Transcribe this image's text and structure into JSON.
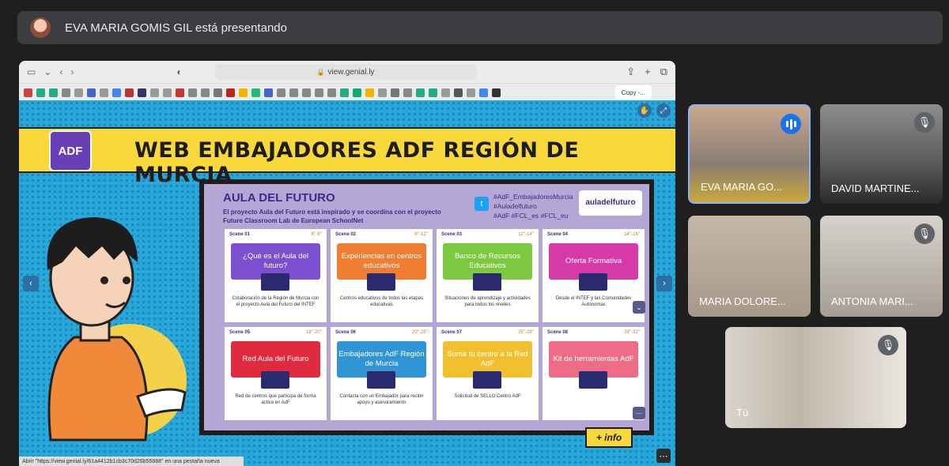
{
  "presenter": {
    "text": "EVA MARIA GOMIS GIL está presentando"
  },
  "browser": {
    "url": "view.genial.ly",
    "active_tab": "Copy -...",
    "status_text": "Abrir \"https://view.genial.ly/61a4412b1cb3c70d26b55888\" en una pestaña nueva"
  },
  "genially": {
    "title": "WEB EMBAJADORES ADF REGIÓN DE MURCIA",
    "logo_text": "ADF",
    "panel": {
      "title": "AULA DEL FUTURO",
      "description": "El proyecto Aula del Futuro está inspirado y se coordina con el proyecto Future Classroom Lab de European SchoolNet",
      "tags": [
        "#AdF_EmbajadoresMurcia",
        "#Auladelfuturo",
        "#AdF #FCL_es #FCL_eu"
      ],
      "logo": "auladelfuturo"
    },
    "scenes": [
      {
        "label": "Scene 01",
        "time": "6''-9''",
        "title": "¿Qué es el Aula del futuro?",
        "desc": "Colaboración de la Región de Murcia con el proyecto Aula del Futuro del INTEF",
        "color": "#7b4fd0"
      },
      {
        "label": "Scene 02",
        "time": "9''-12''",
        "title": "Experiencias en centros educativos",
        "desc": "Centros educativos de todos las etapas educativas",
        "color": "#f07d32"
      },
      {
        "label": "Scene 03",
        "time": "12''-14''",
        "title": "Banco de Recursos Educativos",
        "desc": "Situaciones de aprendizaje y actividades para todos los niveles",
        "color": "#7cc83f"
      },
      {
        "label": "Scene 04",
        "time": "14''-18''",
        "title": "Oferta Formativa",
        "desc": "Desde el INTEF y las Comunidades Autónomas",
        "color": "#d63aa8"
      },
      {
        "label": "Scene 05",
        "time": "18''-20''",
        "title": "Red Aula del Futuro",
        "desc": "Red de centros que participa de forma activa en AdF",
        "color": "#e02a3e"
      },
      {
        "label": "Scene 06",
        "time": "20''-25''",
        "title": "Embajadores AdF Región de Murcia",
        "desc": "Contacta con un Embajador para recibir apoyo y asesoramiento",
        "color": "#2f95d4"
      },
      {
        "label": "Scene 07",
        "time": "25''-28''",
        "title": "Suma tu centro a la Red AdF",
        "desc": "Solicitud de SELLO Centro AdF",
        "color": "#f2c02e"
      },
      {
        "label": "Scene 08",
        "time": "28''-32''",
        "title": "Kit de herramientas AdF",
        "desc": "",
        "color": "#ee6d86"
      }
    ],
    "info_button": "+ info"
  },
  "participants": [
    {
      "name": "EVA MARIA GO...",
      "muted": false,
      "speaking": true
    },
    {
      "name": "DAVID MARTINE...",
      "muted": true,
      "speaking": false
    },
    {
      "name": "MARIA DOLORE...",
      "muted": false,
      "speaking": false
    },
    {
      "name": "ANTONIA MARI...",
      "muted": true,
      "speaking": false
    },
    {
      "name": "Tú",
      "muted": true,
      "speaking": false
    }
  ]
}
